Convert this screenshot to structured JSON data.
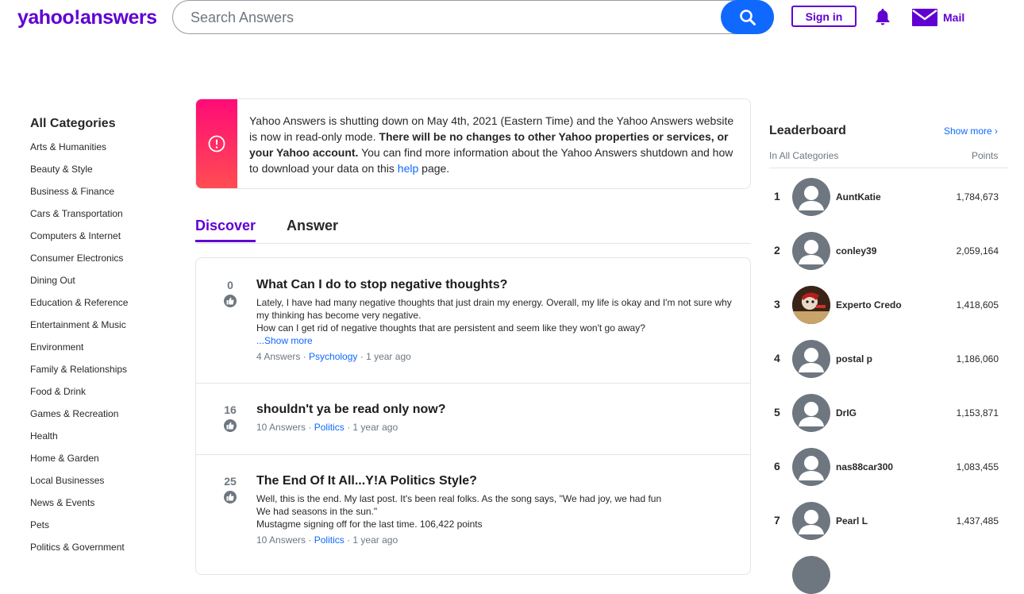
{
  "header": {
    "logo": "yahoo!answers",
    "search_placeholder": "Search Answers",
    "signin_label": "Sign in",
    "mail_label": "Mail"
  },
  "categories": {
    "title": "All Categories",
    "items": [
      "Arts & Humanities",
      "Beauty & Style",
      "Business & Finance",
      "Cars & Transportation",
      "Computers & Internet",
      "Consumer Electronics",
      "Dining Out",
      "Education & Reference",
      "Entertainment & Music",
      "Environment",
      "Family & Relationships",
      "Food & Drink",
      "Games & Recreation",
      "Health",
      "Home & Garden",
      "Local Businesses",
      "News & Events",
      "Pets",
      "Politics & Government"
    ]
  },
  "banner": {
    "text_1": "Yahoo Answers is shutting down on May 4th, 2021 (Eastern Time) and the Yahoo Answers website is now in read-only mode. ",
    "text_bold": "There will be no changes to other Yahoo properties or services, or your Yahoo account.",
    "text_2": " You can find more information about the Yahoo Answers shutdown and how to download your data on this ",
    "link": "help",
    "text_3": " page."
  },
  "tabs": {
    "discover": "Discover",
    "answer": "Answer"
  },
  "questions": [
    {
      "votes": "0",
      "title": "What Can I do to stop negative thoughts?",
      "body_lines": [
        "Lately, I have had many negative thoughts that just drain my energy.   Overall, my life is okay and I'm not sure why my thinking has become very negative.",
        "How can I get rid of negative thoughts that are persistent and seem like they won't go away?"
      ],
      "show_more": "...Show more",
      "answers": "4 Answers",
      "category": "Psychology",
      "time": "1 year ago"
    },
    {
      "votes": "16",
      "title": "shouldn't ya be read only now?",
      "answers": "10 Answers",
      "category": "Politics",
      "time": "1 year ago"
    },
    {
      "votes": "25",
      "title": "The End Of It All...Y!A Politics Style?",
      "body_lines": [
        "Well, this is the end. My last post. It's been real folks. As the song says, \"We had joy, we had fun",
        "We had seasons in the sun.\"",
        "Mustagme signing off for the last time. 106,422 points"
      ],
      "answers": "10 Answers",
      "category": "Politics",
      "time": "1 year ago"
    }
  ],
  "meta_separator": " · ",
  "leaderboard": {
    "title": "Leaderboard",
    "show_more": "Show more ›",
    "subtitle": "In All Categories",
    "points_label": "Points",
    "entries": [
      {
        "rank": "1",
        "name": "AuntKatie",
        "points": "1,784,673"
      },
      {
        "rank": "2",
        "name": "conley39",
        "points": "2,059,164"
      },
      {
        "rank": "3",
        "name": "Experto Credo",
        "points": "1,418,605"
      },
      {
        "rank": "4",
        "name": "postal p",
        "points": "1,186,060"
      },
      {
        "rank": "5",
        "name": "DrIG",
        "points": "1,153,871"
      },
      {
        "rank": "6",
        "name": "nas88car300",
        "points": "1,083,455"
      },
      {
        "rank": "7",
        "name": "Pearl L",
        "points": "1,437,485"
      }
    ]
  },
  "colors": {
    "brand": "#6001d2",
    "accent_blue": "#0f69ff",
    "alert_pink": "#ff0b77"
  }
}
